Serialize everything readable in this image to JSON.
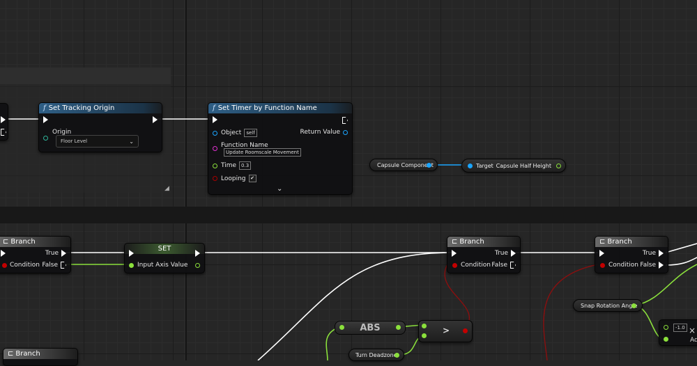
{
  "nodes": {
    "set_tracking_origin": {
      "title": "Set Tracking Origin",
      "origin_label": "Origin",
      "origin_value": "Floor Level"
    },
    "set_timer": {
      "title": "Set Timer by Function Name",
      "object_label": "Object",
      "object_value": "self",
      "return_label": "Return Value",
      "function_name_label": "Function Name",
      "function_name_value": "Update Roomscale Movement",
      "time_label": "Time",
      "time_value": "0.3",
      "looping_label": "Looping",
      "looping_value": "✔",
      "expand_glyph": "⌄"
    },
    "capsule_component": {
      "label": "Capsule Component"
    },
    "capsule_half_height": {
      "target_label": "Target",
      "label": "Capsule Half Height"
    },
    "branch_left": {
      "title": "Branch",
      "true_label": "True",
      "false_label": "False",
      "condition_label": "Condition"
    },
    "set_node": {
      "title": "SET",
      "input_label": "Input Axis Value"
    },
    "branch_mid": {
      "title": "Branch",
      "true_label": "True",
      "false_label": "False",
      "condition_label": "Condition"
    },
    "branch_right": {
      "title": "Branch",
      "true_label": "True",
      "false_label": "False",
      "condition_label": "Condition"
    },
    "snap_rotation": {
      "label": "Snap Rotation Angle"
    },
    "abs_node": {
      "label": "ABS"
    },
    "greater_node": {
      "label": ">"
    },
    "turn_deadzone": {
      "label": "Turn Deadzone"
    },
    "mult_node": {
      "value": "-1.0",
      "op": "×",
      "partial_label": "Ad"
    },
    "branch_bottom": {
      "title": "Branch"
    }
  },
  "colors": {
    "exec": "#ffffff",
    "float_pin": "#8be03c",
    "object_pin": "#1aa5ff",
    "bool_pin": "#c20000",
    "struct_pin": "#2fb59a",
    "name_pin": "#e030d0",
    "bool_wire": "#8a0f0f"
  }
}
